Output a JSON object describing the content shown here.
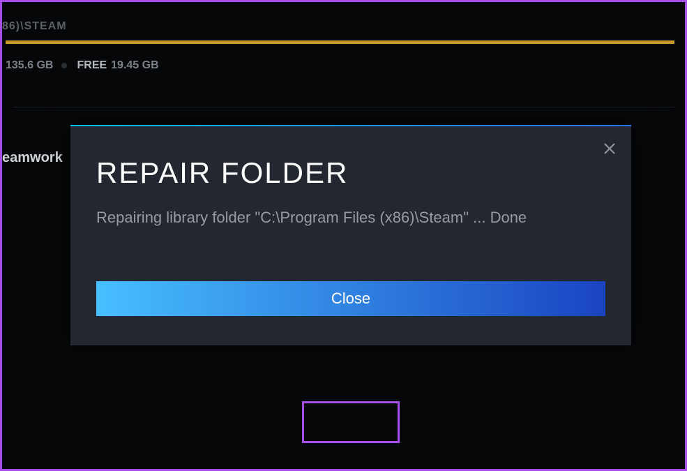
{
  "background": {
    "path_fragment": "86)\\STEAM",
    "used_size": "135.6 GB",
    "free_label": "FREE",
    "free_size": "19.45 GB",
    "partial_text": "eamwork"
  },
  "dialog": {
    "title": "REPAIR FOLDER",
    "message": "Repairing library folder \"C:\\Program Files (x86)\\Steam\" ... Done",
    "close_button_label": "Close"
  }
}
